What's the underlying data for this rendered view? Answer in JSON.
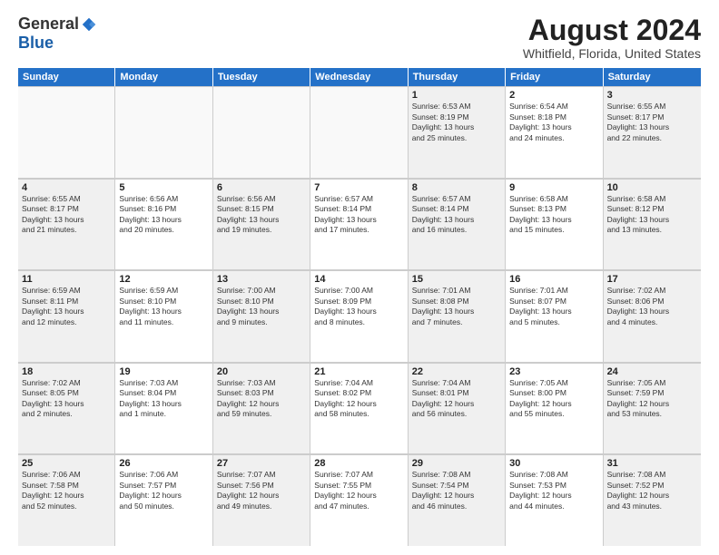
{
  "logo": {
    "general": "General",
    "blue": "Blue"
  },
  "title": "August 2024",
  "subtitle": "Whitfield, Florida, United States",
  "header_days": [
    "Sunday",
    "Monday",
    "Tuesday",
    "Wednesday",
    "Thursday",
    "Friday",
    "Saturday"
  ],
  "weeks": [
    [
      {
        "day": "",
        "info": ""
      },
      {
        "day": "",
        "info": ""
      },
      {
        "day": "",
        "info": ""
      },
      {
        "day": "",
        "info": ""
      },
      {
        "day": "1",
        "info": "Sunrise: 6:53 AM\nSunset: 8:19 PM\nDaylight: 13 hours\nand 25 minutes."
      },
      {
        "day": "2",
        "info": "Sunrise: 6:54 AM\nSunset: 8:18 PM\nDaylight: 13 hours\nand 24 minutes."
      },
      {
        "day": "3",
        "info": "Sunrise: 6:55 AM\nSunset: 8:17 PM\nDaylight: 13 hours\nand 22 minutes."
      }
    ],
    [
      {
        "day": "4",
        "info": "Sunrise: 6:55 AM\nSunset: 8:17 PM\nDaylight: 13 hours\nand 21 minutes."
      },
      {
        "day": "5",
        "info": "Sunrise: 6:56 AM\nSunset: 8:16 PM\nDaylight: 13 hours\nand 20 minutes."
      },
      {
        "day": "6",
        "info": "Sunrise: 6:56 AM\nSunset: 8:15 PM\nDaylight: 13 hours\nand 19 minutes."
      },
      {
        "day": "7",
        "info": "Sunrise: 6:57 AM\nSunset: 8:14 PM\nDaylight: 13 hours\nand 17 minutes."
      },
      {
        "day": "8",
        "info": "Sunrise: 6:57 AM\nSunset: 8:14 PM\nDaylight: 13 hours\nand 16 minutes."
      },
      {
        "day": "9",
        "info": "Sunrise: 6:58 AM\nSunset: 8:13 PM\nDaylight: 13 hours\nand 15 minutes."
      },
      {
        "day": "10",
        "info": "Sunrise: 6:58 AM\nSunset: 8:12 PM\nDaylight: 13 hours\nand 13 minutes."
      }
    ],
    [
      {
        "day": "11",
        "info": "Sunrise: 6:59 AM\nSunset: 8:11 PM\nDaylight: 13 hours\nand 12 minutes."
      },
      {
        "day": "12",
        "info": "Sunrise: 6:59 AM\nSunset: 8:10 PM\nDaylight: 13 hours\nand 11 minutes."
      },
      {
        "day": "13",
        "info": "Sunrise: 7:00 AM\nSunset: 8:10 PM\nDaylight: 13 hours\nand 9 minutes."
      },
      {
        "day": "14",
        "info": "Sunrise: 7:00 AM\nSunset: 8:09 PM\nDaylight: 13 hours\nand 8 minutes."
      },
      {
        "day": "15",
        "info": "Sunrise: 7:01 AM\nSunset: 8:08 PM\nDaylight: 13 hours\nand 7 minutes."
      },
      {
        "day": "16",
        "info": "Sunrise: 7:01 AM\nSunset: 8:07 PM\nDaylight: 13 hours\nand 5 minutes."
      },
      {
        "day": "17",
        "info": "Sunrise: 7:02 AM\nSunset: 8:06 PM\nDaylight: 13 hours\nand 4 minutes."
      }
    ],
    [
      {
        "day": "18",
        "info": "Sunrise: 7:02 AM\nSunset: 8:05 PM\nDaylight: 13 hours\nand 2 minutes."
      },
      {
        "day": "19",
        "info": "Sunrise: 7:03 AM\nSunset: 8:04 PM\nDaylight: 13 hours\nand 1 minute."
      },
      {
        "day": "20",
        "info": "Sunrise: 7:03 AM\nSunset: 8:03 PM\nDaylight: 12 hours\nand 59 minutes."
      },
      {
        "day": "21",
        "info": "Sunrise: 7:04 AM\nSunset: 8:02 PM\nDaylight: 12 hours\nand 58 minutes."
      },
      {
        "day": "22",
        "info": "Sunrise: 7:04 AM\nSunset: 8:01 PM\nDaylight: 12 hours\nand 56 minutes."
      },
      {
        "day": "23",
        "info": "Sunrise: 7:05 AM\nSunset: 8:00 PM\nDaylight: 12 hours\nand 55 minutes."
      },
      {
        "day": "24",
        "info": "Sunrise: 7:05 AM\nSunset: 7:59 PM\nDaylight: 12 hours\nand 53 minutes."
      }
    ],
    [
      {
        "day": "25",
        "info": "Sunrise: 7:06 AM\nSunset: 7:58 PM\nDaylight: 12 hours\nand 52 minutes."
      },
      {
        "day": "26",
        "info": "Sunrise: 7:06 AM\nSunset: 7:57 PM\nDaylight: 12 hours\nand 50 minutes."
      },
      {
        "day": "27",
        "info": "Sunrise: 7:07 AM\nSunset: 7:56 PM\nDaylight: 12 hours\nand 49 minutes."
      },
      {
        "day": "28",
        "info": "Sunrise: 7:07 AM\nSunset: 7:55 PM\nDaylight: 12 hours\nand 47 minutes."
      },
      {
        "day": "29",
        "info": "Sunrise: 7:08 AM\nSunset: 7:54 PM\nDaylight: 12 hours\nand 46 minutes."
      },
      {
        "day": "30",
        "info": "Sunrise: 7:08 AM\nSunset: 7:53 PM\nDaylight: 12 hours\nand 44 minutes."
      },
      {
        "day": "31",
        "info": "Sunrise: 7:08 AM\nSunset: 7:52 PM\nDaylight: 12 hours\nand 43 minutes."
      }
    ]
  ]
}
